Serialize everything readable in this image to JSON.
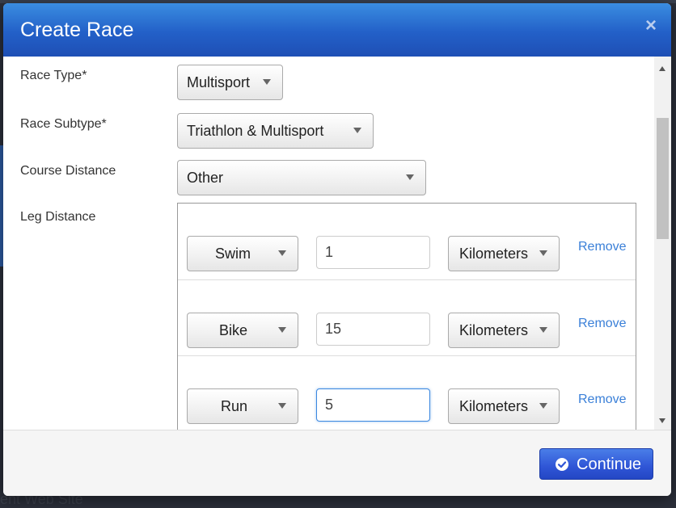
{
  "background": {
    "partial_text": "ent Web Site"
  },
  "modal": {
    "title": "Create Race",
    "close_glyph": "×"
  },
  "fields": {
    "race_type": {
      "label": "Race Type*",
      "value": "Multisport"
    },
    "race_subtype": {
      "label": "Race Subtype*",
      "value": "Triathlon & Multisport"
    },
    "course_distance": {
      "label": "Course Distance",
      "value": "Other"
    },
    "leg_distance": {
      "label": "Leg Distance"
    }
  },
  "legs": [
    {
      "sport": "Swim",
      "distance": "1",
      "unit": "Kilometers",
      "remove_label": "Remove"
    },
    {
      "sport": "Bike",
      "distance": "15",
      "unit": "Kilometers",
      "remove_label": "Remove"
    },
    {
      "sport": "Run",
      "distance": "5",
      "unit": "Kilometers",
      "remove_label": "Remove"
    }
  ],
  "footer": {
    "continue_label": "Continue",
    "continue_icon": "check-circle-icon"
  },
  "colors": {
    "header": "#2360c8",
    "link": "#3b80d8",
    "primary_button": "#2f55d6"
  }
}
